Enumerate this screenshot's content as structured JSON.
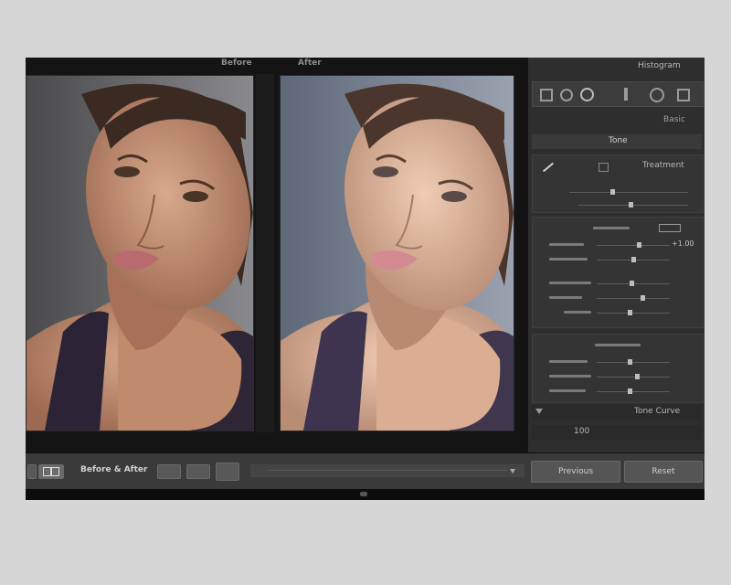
{
  "view": {
    "before_label": "Before",
    "after_label": "After",
    "mode_label": "Before & After"
  },
  "panel": {
    "header_label": "Histogram",
    "preset_label": "Basic",
    "tab_active": "Tone",
    "color_label": "Treatment",
    "exposure_value": "+1.00",
    "bottom_label": "Tone Curve",
    "zoom_value": "100"
  },
  "toolbar": {
    "previous_label": "Previous",
    "reset_label": "Reset"
  },
  "colors": {
    "panel_bg": "#2e2e2e",
    "toolbar_bg": "#3a3a3a",
    "accent": "#bdbdbd"
  }
}
